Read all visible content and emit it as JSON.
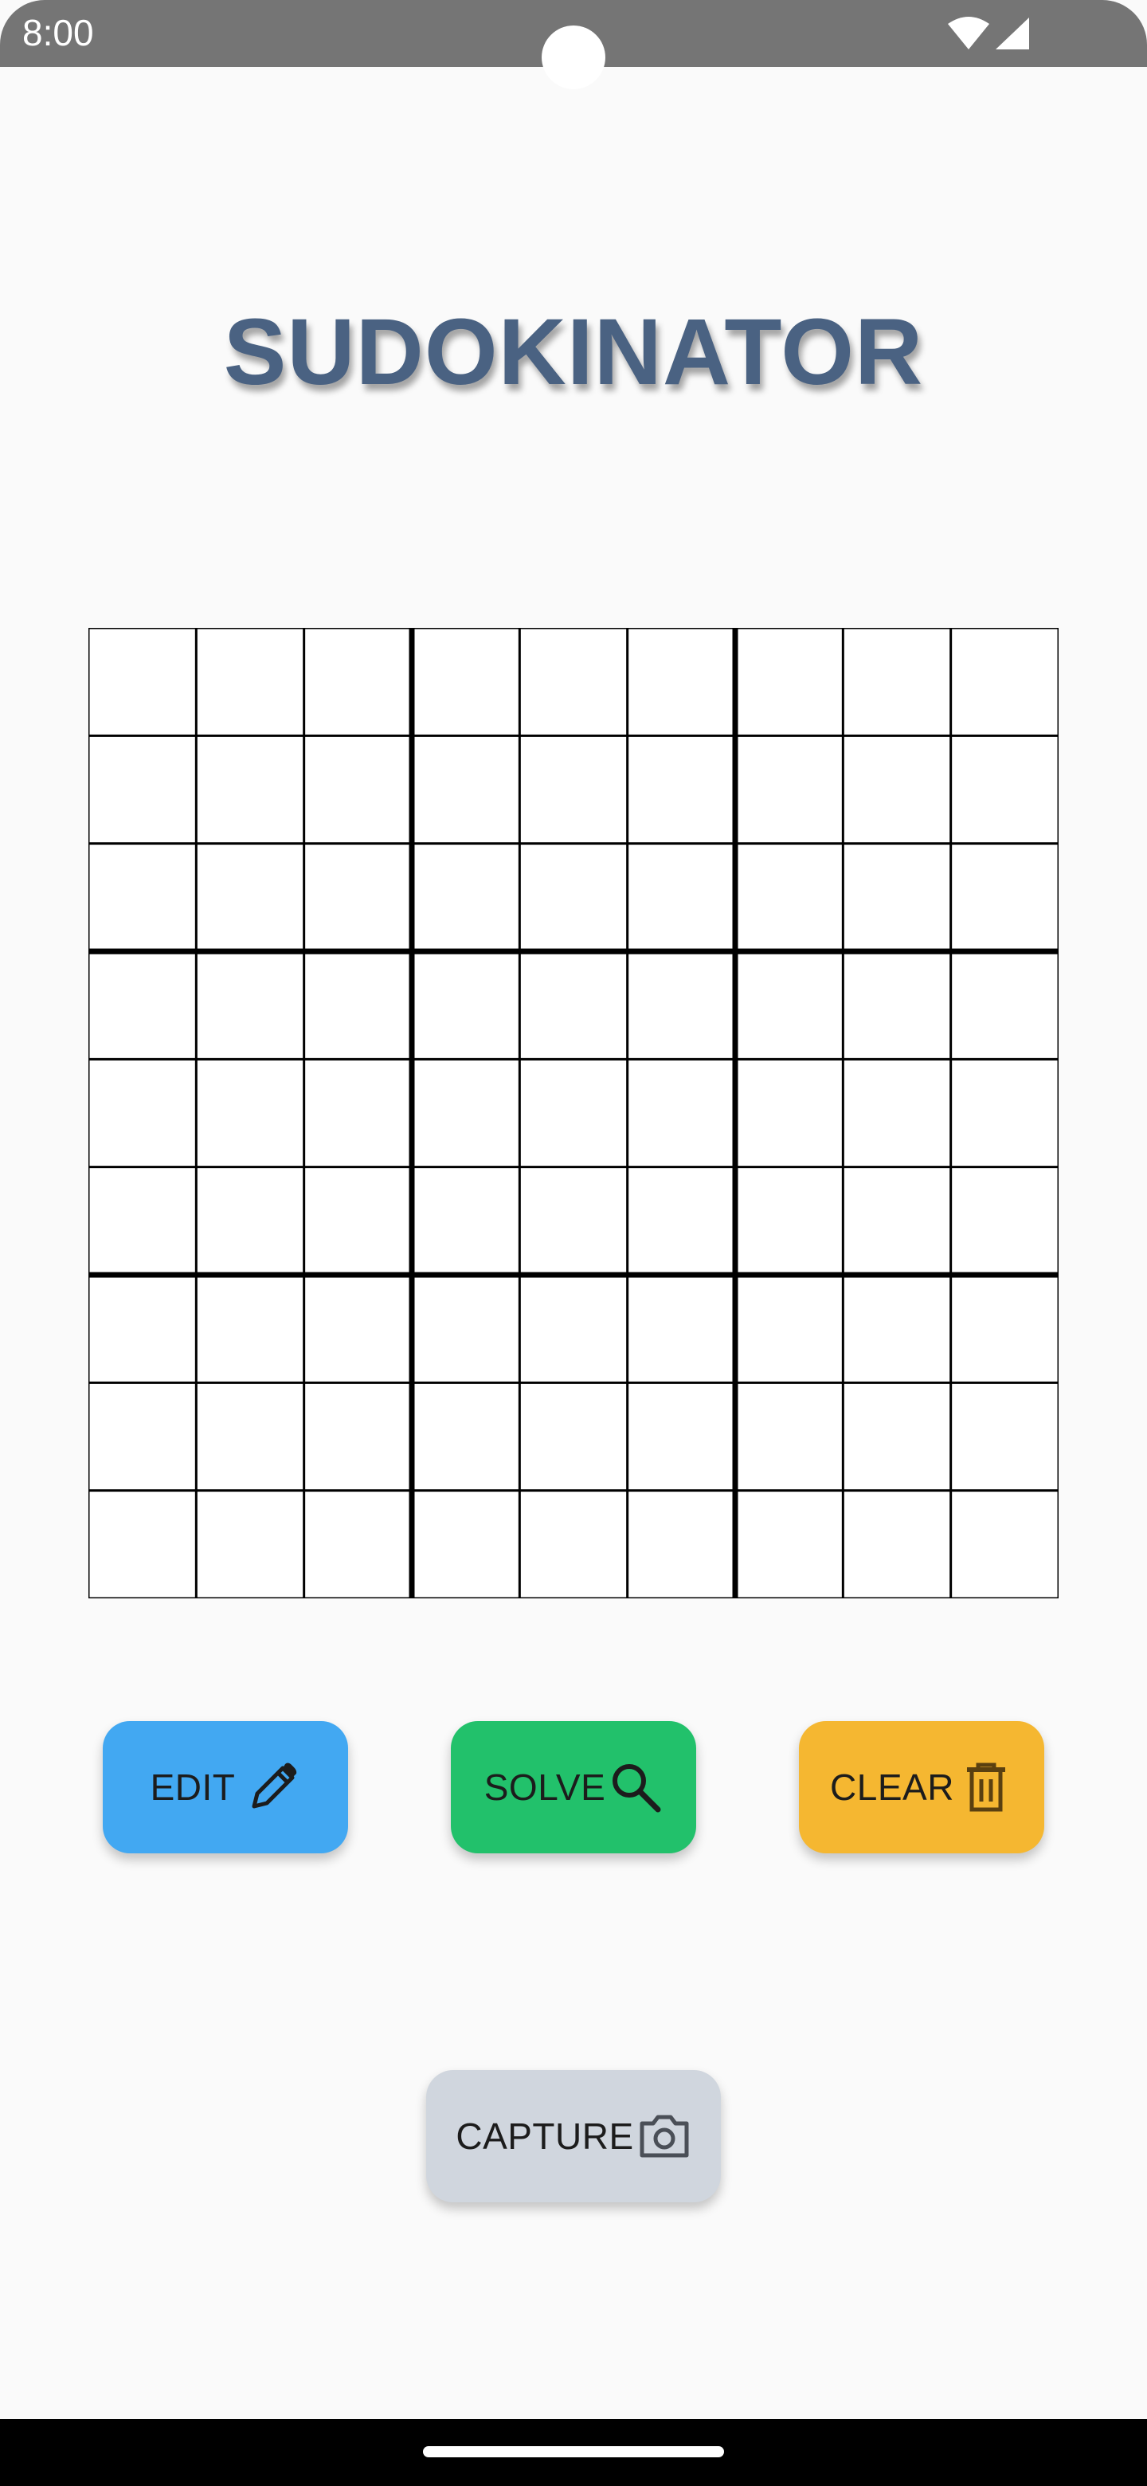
{
  "status_bar": {
    "time": "8:00",
    "icons": [
      "wifi-icon",
      "signal-icon"
    ]
  },
  "title": "SUDOKINATOR",
  "grid": {
    "rows": 9,
    "cols": 9,
    "cells": [
      [
        "",
        "",
        "",
        "",
        "",
        "",
        "",
        "",
        ""
      ],
      [
        "",
        "",
        "",
        "",
        "",
        "",
        "",
        "",
        ""
      ],
      [
        "",
        "",
        "",
        "",
        "",
        "",
        "",
        "",
        ""
      ],
      [
        "",
        "",
        "",
        "",
        "",
        "",
        "",
        "",
        ""
      ],
      [
        "",
        "",
        "",
        "",
        "",
        "",
        "",
        "",
        ""
      ],
      [
        "",
        "",
        "",
        "",
        "",
        "",
        "",
        "",
        ""
      ],
      [
        "",
        "",
        "",
        "",
        "",
        "",
        "",
        "",
        ""
      ],
      [
        "",
        "",
        "",
        "",
        "",
        "",
        "",
        "",
        ""
      ],
      [
        "",
        "",
        "",
        "",
        "",
        "",
        "",
        "",
        ""
      ]
    ]
  },
  "buttons": {
    "edit": {
      "label": "EDIT",
      "icon": "pencil-icon",
      "color": "#42a8f2"
    },
    "solve": {
      "label": "SOLVE",
      "icon": "search-icon",
      "color": "#22c16b"
    },
    "clear": {
      "label": "CLEAR",
      "icon": "trash-icon",
      "color": "#f5b731"
    },
    "capture": {
      "label": "CAPTURE",
      "icon": "camera-icon",
      "color": "#d0d6de"
    }
  },
  "colors": {
    "title": "#4a6282",
    "status_bar": "#757575",
    "background": "#fafafa"
  }
}
